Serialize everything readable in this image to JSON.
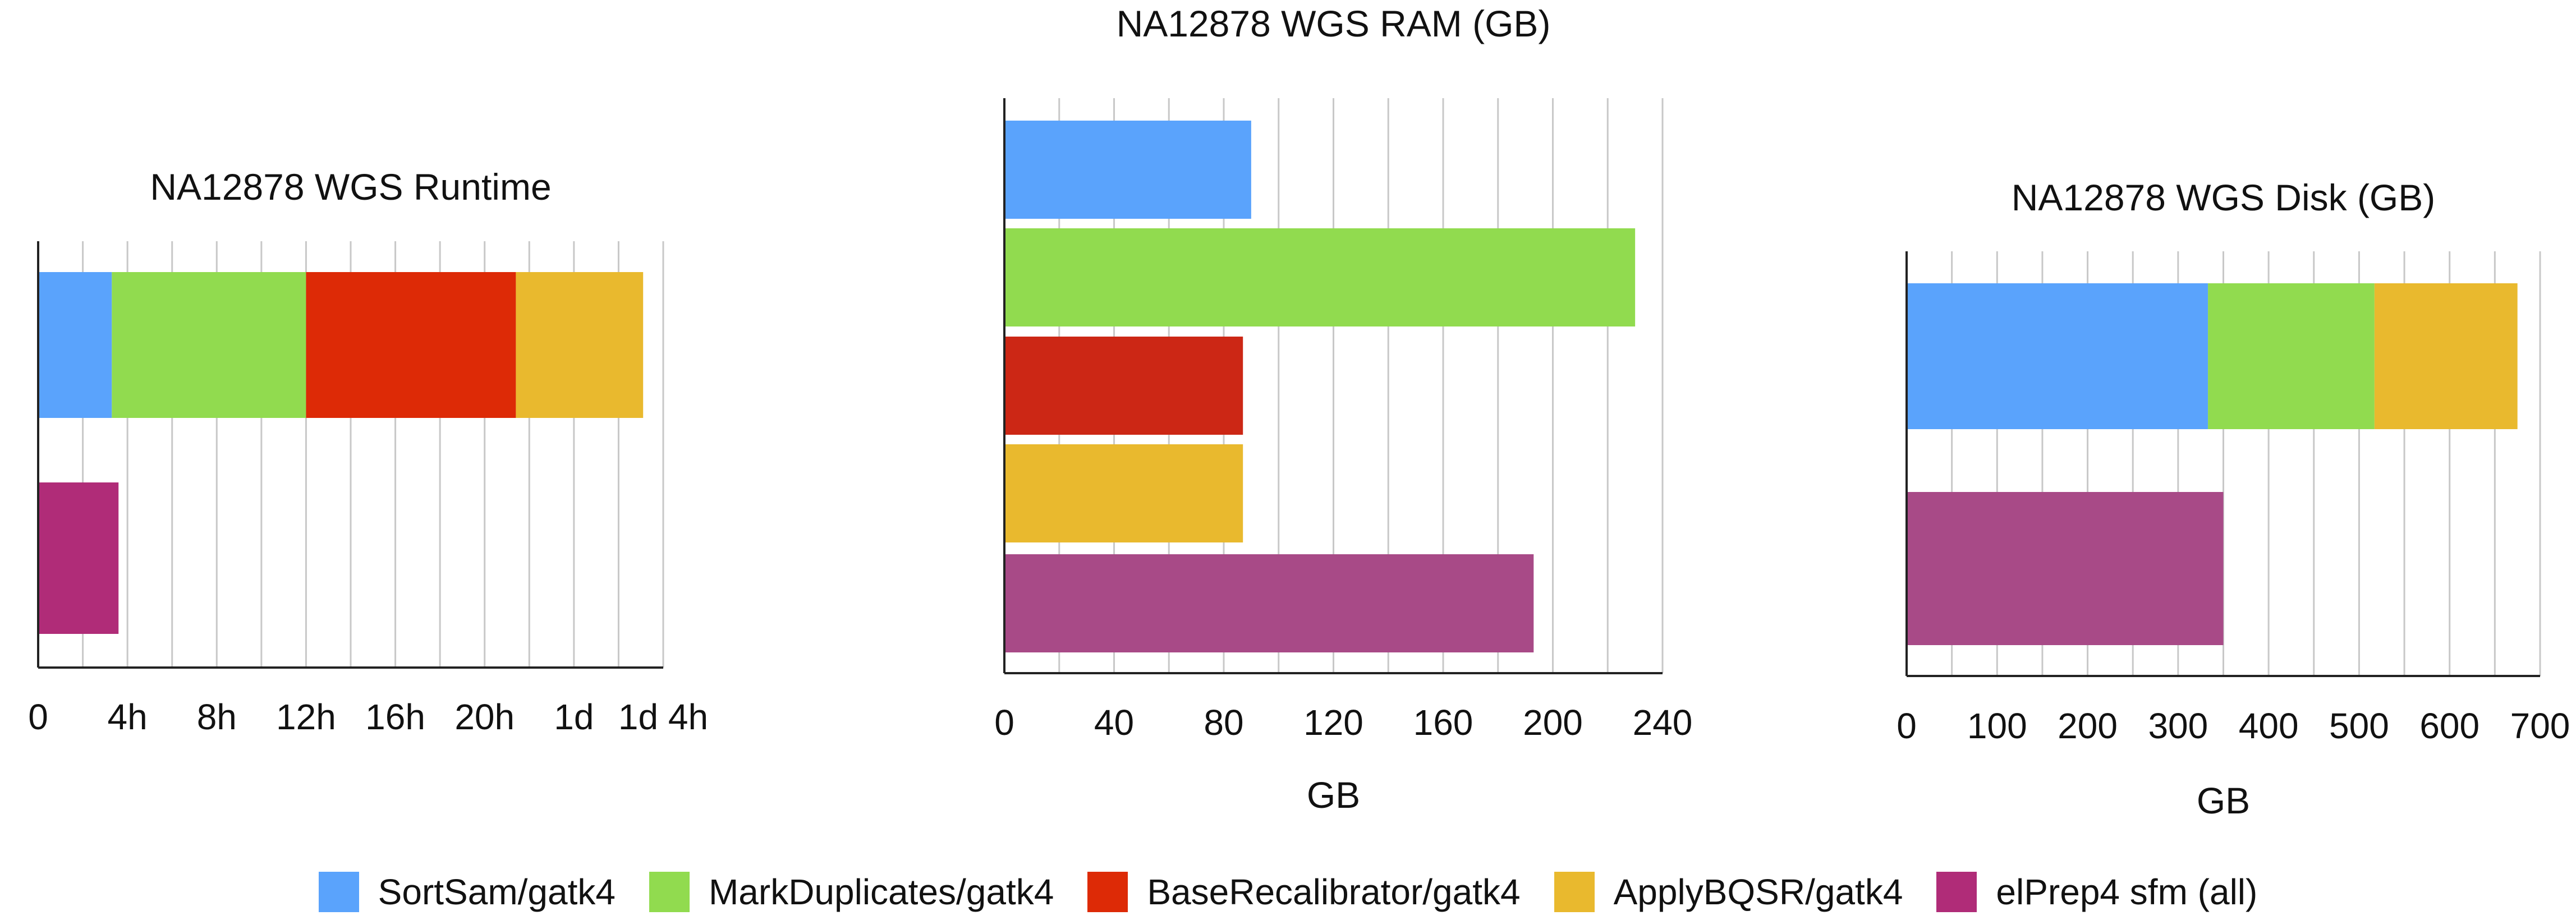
{
  "series_colors": {
    "SortSam/gatk4": "#5aa3fc",
    "MarkDuplicates/gatk4": "#91db4f",
    "BaseRecalibrator/gatk4": "#dd2a06",
    "ApplyBQSR/gatk4": "#e9b92e",
    "elPrep4 sfm (all)": "#b02c78"
  },
  "legend": [
    {
      "label": "SortSam/gatk4",
      "color": "#5aa3fc"
    },
    {
      "label": "MarkDuplicates/gatk4",
      "color": "#91db4f"
    },
    {
      "label": "BaseRecalibrator/gatk4",
      "color": "#dd2a06"
    },
    {
      "label": "ApplyBQSR/gatk4",
      "color": "#e9b92e"
    },
    {
      "label": "elPrep4 sfm (all)",
      "color": "#b02c78"
    }
  ],
  "chart_data": [
    {
      "type": "bar",
      "orientation": "horizontal",
      "stacked": true,
      "title": "NA12878 WGS Runtime",
      "xlabel": "",
      "xlim": [
        0,
        28
      ],
      "x_unit": "hours",
      "gridlines": true,
      "tick_values": [
        0,
        4,
        8,
        12,
        16,
        20,
        24,
        28
      ],
      "tick_labels": [
        "0",
        "4h",
        "8h",
        "12h",
        "16h",
        "20h",
        "1d",
        "1d 4h"
      ],
      "rows": [
        {
          "segments": [
            {
              "series": "SortSam/gatk4",
              "value": 3.3,
              "color": "#5aa3fc"
            },
            {
              "series": "MarkDuplicates/gatk4",
              "value": 8.7,
              "color": "#91db4f"
            },
            {
              "series": "BaseRecalibrator/gatk4",
              "value": 9.4,
              "color": "#dd2a06"
            },
            {
              "series": "ApplyBQSR/gatk4",
              "value": 5.7,
              "color": "#e9b92e"
            }
          ]
        },
        {
          "segments": [
            {
              "series": "elPrep4 sfm (all)",
              "value": 3.6,
              "color": "#b02c78"
            }
          ]
        }
      ]
    },
    {
      "type": "bar",
      "orientation": "horizontal",
      "stacked": false,
      "title": "NA12878 WGS RAM (GB)",
      "xlabel": "GB",
      "xlim": [
        0,
        240
      ],
      "gridlines": true,
      "tick_values": [
        0,
        40,
        80,
        120,
        160,
        200,
        240
      ],
      "tick_labels": [
        "0",
        "40",
        "80",
        "120",
        "160",
        "200",
        "240"
      ],
      "bars": [
        {
          "series": "SortSam/gatk4",
          "value": 90,
          "color": "#5aa3fc"
        },
        {
          "series": "MarkDuplicates/gatk4",
          "value": 230,
          "color": "#91db4f"
        },
        {
          "series": "BaseRecalibrator/gatk4",
          "value": 87,
          "color": "#cc2715"
        },
        {
          "series": "ApplyBQSR/gatk4",
          "value": 87,
          "color": "#e9b92e"
        },
        {
          "series": "elPrep4 sfm (all)",
          "value": 193,
          "color": "#a84a87"
        }
      ]
    },
    {
      "type": "bar",
      "orientation": "horizontal",
      "stacked": true,
      "title": "NA12878 WGS Disk (GB)",
      "xlabel": "GB",
      "xlim": [
        0,
        700
      ],
      "gridlines": true,
      "tick_values": [
        0,
        100,
        200,
        300,
        400,
        500,
        600,
        700
      ],
      "tick_labels": [
        "0",
        "100",
        "200",
        "300",
        "400",
        "500",
        "600",
        "700"
      ],
      "rows": [
        {
          "segments": [
            {
              "series": "SortSam/gatk4",
              "value": 333,
              "color": "#5aa3fc"
            },
            {
              "series": "MarkDuplicates/gatk4",
              "value": 184,
              "color": "#91db4f"
            },
            {
              "series": "ApplyBQSR/gatk4",
              "value": 158,
              "color": "#e9b92e"
            }
          ]
        },
        {
          "segments": [
            {
              "series": "elPrep4 sfm (all)",
              "value": 350,
              "color": "#a84a87"
            }
          ]
        }
      ]
    }
  ]
}
